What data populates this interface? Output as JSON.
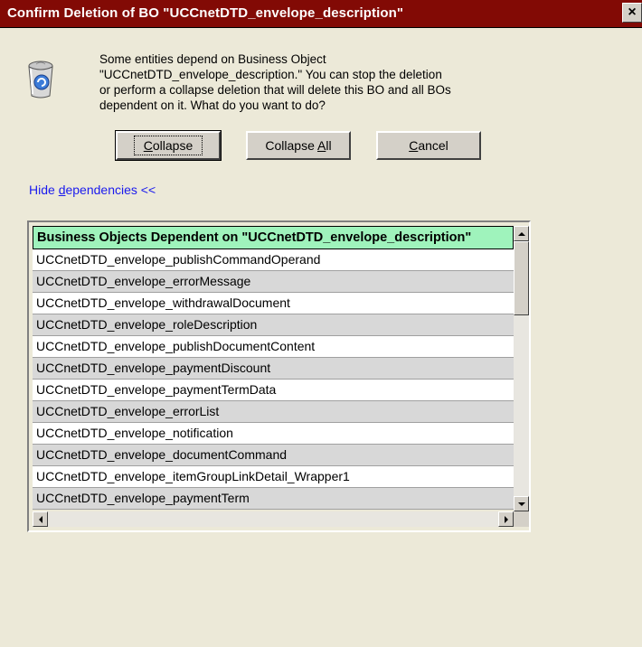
{
  "window": {
    "title": "Confirm Deletion of BO \"UCCnetDTD_envelope_description\"",
    "close_glyph": "×",
    "title_bar_color": "#820a05"
  },
  "dialog": {
    "icon": "recycle-bin-icon",
    "message_lines": [
      "Some entities depend on Business Object",
      "\"UCCnetDTD_envelope_description.\" You can stop the deletion",
      "or perform a collapse deletion that will delete this BO and all BOs",
      "dependent on it. What do you want to do?"
    ]
  },
  "buttons": {
    "collapse_pre": "",
    "collapse_mnemonic": "C",
    "collapse_post": "ollapse",
    "collapse_all_pre": "Collapse ",
    "collapse_all_mnemonic": "A",
    "collapse_all_post": "ll",
    "cancel_pre": "",
    "cancel_mnemonic": "C",
    "cancel_post": "ancel"
  },
  "toggle_link": {
    "pre": "Hide ",
    "mnemonic": "d",
    "post": "ependencies <<",
    "color": "#1a1aee"
  },
  "table": {
    "header": "Business Objects Dependent on \"UCCnetDTD_envelope_description\"",
    "header_color": "#9ff3bc",
    "rows": [
      "UCCnetDTD_envelope_publishCommandOperand",
      "UCCnetDTD_envelope_errorMessage",
      "UCCnetDTD_envelope_withdrawalDocument",
      "UCCnetDTD_envelope_roleDescription",
      "UCCnetDTD_envelope_publishDocumentContent",
      "UCCnetDTD_envelope_paymentDiscount",
      "UCCnetDTD_envelope_paymentTermData",
      "UCCnetDTD_envelope_errorList",
      "UCCnetDTD_envelope_notification",
      "UCCnetDTD_envelope_documentCommand",
      "UCCnetDTD_envelope_itemGroupLinkDetail_Wrapper1",
      "UCCnetDTD_envelope_paymentTerm"
    ]
  }
}
